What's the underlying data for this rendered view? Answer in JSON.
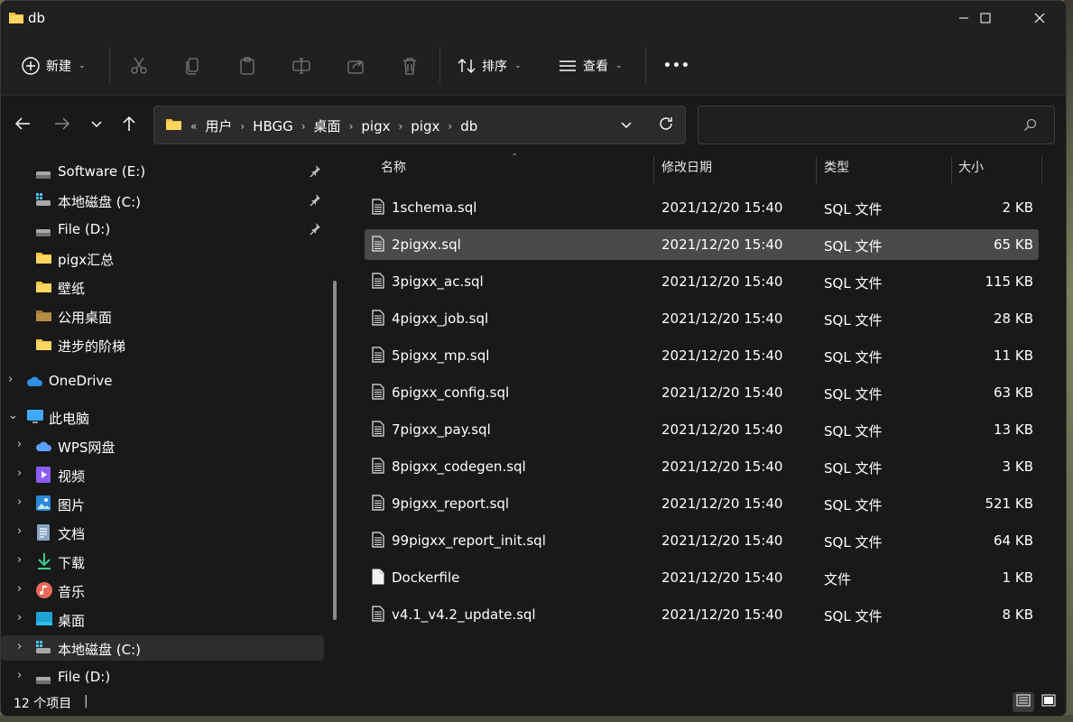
{
  "window": {
    "title": "db"
  },
  "toolbar": {
    "new_label": "新建",
    "sort_label": "排序",
    "view_label": "查看",
    "more_label": "•••"
  },
  "address": {
    "overflow": "«",
    "crumbs": [
      "用户",
      "HBGG",
      "桌面",
      "pigx",
      "pigx",
      "db"
    ],
    "separator": "›"
  },
  "search": {
    "placeholder": ""
  },
  "sidebar": {
    "pinned": [
      {
        "label": "Software (E:)",
        "icon": "drive-icon"
      },
      {
        "label": "本地磁盘 (C:)",
        "icon": "windows-drive-icon"
      },
      {
        "label": "File (D:)",
        "icon": "drive-icon"
      }
    ],
    "folders": [
      {
        "label": "pigx汇总"
      },
      {
        "label": "壁纸"
      },
      {
        "label": "公用桌面"
      },
      {
        "label": "进步的阶梯"
      }
    ],
    "onedrive": "OneDrive",
    "this_pc": "此电脑",
    "pc_items": [
      {
        "label": "WPS网盘",
        "icon": "cloud-icon"
      },
      {
        "label": "视频",
        "icon": "video-icon"
      },
      {
        "label": "图片",
        "icon": "picture-icon"
      },
      {
        "label": "文档",
        "icon": "document-icon"
      },
      {
        "label": "下载",
        "icon": "download-icon"
      },
      {
        "label": "音乐",
        "icon": "music-icon"
      },
      {
        "label": "桌面",
        "icon": "desktop-icon"
      },
      {
        "label": "本地磁盘 (C:)",
        "icon": "windows-drive-icon"
      },
      {
        "label": "File (D:)",
        "icon": "drive-icon"
      }
    ]
  },
  "columns": {
    "name": "名称",
    "modified": "修改日期",
    "type": "类型",
    "size": "大小"
  },
  "files": [
    {
      "name": "1schema.sql",
      "date": "2021/12/20 15:40",
      "type": "SQL 文件",
      "size": "2 KB"
    },
    {
      "name": "2pigxx.sql",
      "date": "2021/12/20 15:40",
      "type": "SQL 文件",
      "size": "65 KB"
    },
    {
      "name": "3pigxx_ac.sql",
      "date": "2021/12/20 15:40",
      "type": "SQL 文件",
      "size": "115 KB"
    },
    {
      "name": "4pigxx_job.sql",
      "date": "2021/12/20 15:40",
      "type": "SQL 文件",
      "size": "28 KB"
    },
    {
      "name": "5pigxx_mp.sql",
      "date": "2021/12/20 15:40",
      "type": "SQL 文件",
      "size": "11 KB"
    },
    {
      "name": "6pigxx_config.sql",
      "date": "2021/12/20 15:40",
      "type": "SQL 文件",
      "size": "63 KB"
    },
    {
      "name": "7pigxx_pay.sql",
      "date": "2021/12/20 15:40",
      "type": "SQL 文件",
      "size": "13 KB"
    },
    {
      "name": "8pigxx_codegen.sql",
      "date": "2021/12/20 15:40",
      "type": "SQL 文件",
      "size": "3 KB"
    },
    {
      "name": "9pigxx_report.sql",
      "date": "2021/12/20 15:40",
      "type": "SQL 文件",
      "size": "521 KB"
    },
    {
      "name": "99pigxx_report_init.sql",
      "date": "2021/12/20 15:40",
      "type": "SQL 文件",
      "size": "64 KB"
    },
    {
      "name": "Dockerfile",
      "date": "2021/12/20 15:40",
      "type": "文件",
      "size": "1 KB"
    },
    {
      "name": "v4.1_v4.2_update.sql",
      "date": "2021/12/20 15:40",
      "type": "SQL 文件",
      "size": "8 KB"
    }
  ],
  "status": {
    "count": "12 个项目",
    "separator": "|"
  },
  "colors": {
    "folder": "#f5c33b",
    "accent": "#4cc2ff",
    "selected_row": "#4a4a4a"
  }
}
